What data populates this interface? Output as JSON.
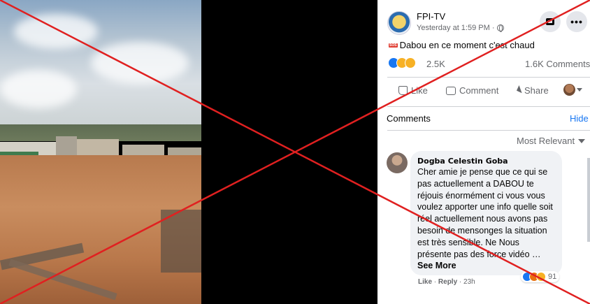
{
  "post": {
    "page_name": "FPI-TV",
    "timestamp": "Yesterday at 1:59 PM · ",
    "text": "Dabou en ce moment c'est chaud",
    "reaction_count": "2.5K",
    "comment_count": "1.6K Comments",
    "actions": {
      "like": "Like",
      "comment": "Comment",
      "share": "Share"
    }
  },
  "comments_section": {
    "title": "Comments",
    "hide_label": "Hide",
    "sort_label": "Most Relevant"
  },
  "comment": {
    "author": "Dogba Celestin Goba",
    "text": "Cher amie je pense que ce qui se pas actuellement a DABOU te réjouis énormément ci vous vous voulez apporter une info quelle soit réel actuellement nous avons pas besoin de mensonges la situation est très sensible. Ne Nous présente pas des force vidéo … ",
    "see_more": "See More",
    "reaction_count": "91",
    "like_label": "Like",
    "reply_label": "Reply",
    "age": "23h"
  },
  "icons": {
    "globe": "globe-icon",
    "messenger": "messenger-icon",
    "more": "more-options-icon",
    "like": "thumbs-up-icon",
    "comment": "comment-bubble-icon",
    "share": "share-arrow-icon"
  },
  "colors": {
    "facebook_blue": "#1877f2",
    "muted_text": "#65676b",
    "cross_red": "#e02020"
  }
}
